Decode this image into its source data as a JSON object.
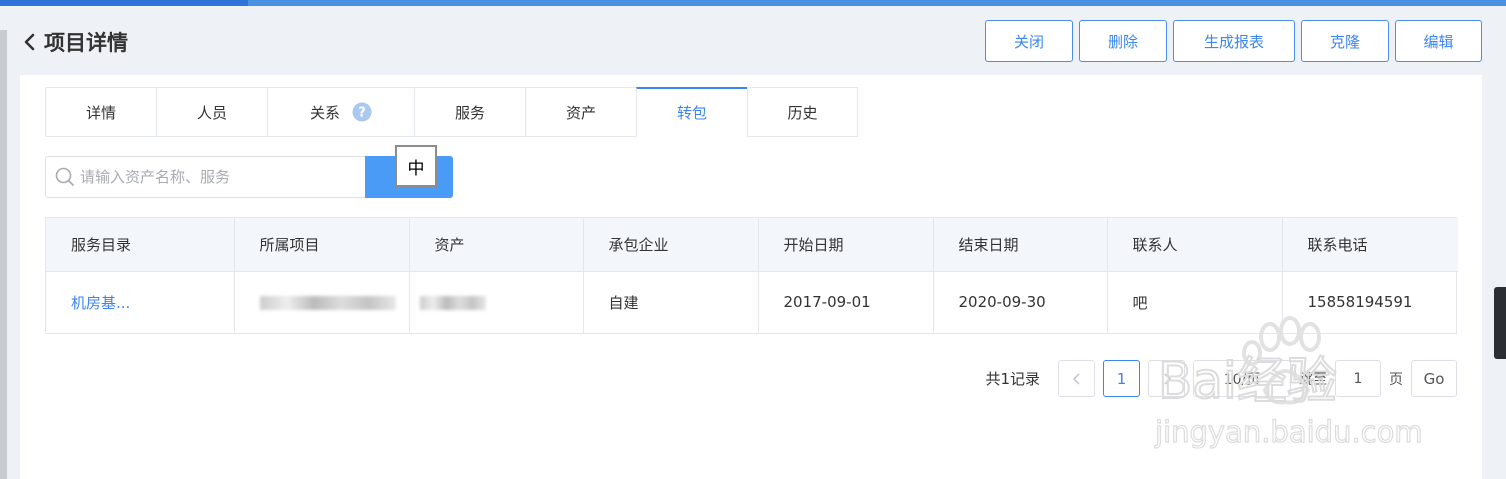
{
  "header": {
    "title": "项目详情"
  },
  "actions": {
    "close": "关闭",
    "delete": "删除",
    "report": "生成报表",
    "clone": "克隆",
    "edit": "编辑"
  },
  "tabs": [
    "详情",
    "人员",
    "关系",
    "服务",
    "资产",
    "转包",
    "历史"
  ],
  "active_tab": "转包",
  "search": {
    "placeholder": "请输入资产名称、服务"
  },
  "ime": {
    "char": "中"
  },
  "table": {
    "headers": [
      "服务目录",
      "所属项目",
      "资产",
      "承包企业",
      "开始日期",
      "结束日期",
      "联系人",
      "联系电话"
    ],
    "rows": [
      {
        "catalog": "机房基...",
        "contractor": "自建",
        "start": "2017-09-01",
        "end": "2020-09-30",
        "contact": "吧",
        "phone": "15858194591"
      }
    ]
  },
  "pagination": {
    "total": "共1记录",
    "current": "1",
    "page_size": "10/页",
    "jump_label": "跳至",
    "jump_value": "1",
    "page_unit": "页",
    "go": "Go"
  },
  "watermark": {
    "brand": "Bai经验",
    "url": "jingyan.baidu.com"
  },
  "colors": {
    "accent": "#3c86ef",
    "topbar": "#4a90e2",
    "header_bg": "#f3f7fc"
  }
}
